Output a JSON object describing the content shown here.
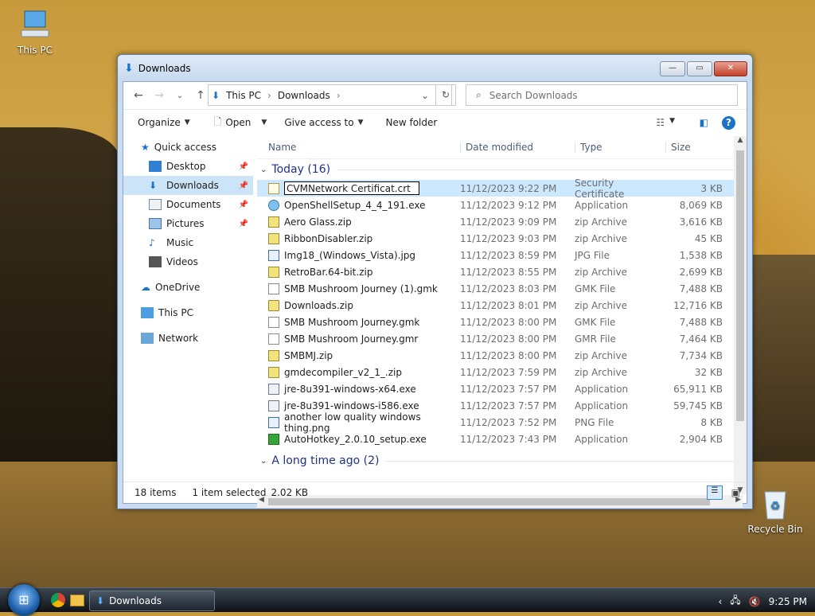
{
  "desktop": {
    "this_pc_label": "This PC",
    "recycle_bin_label": "Recycle Bin"
  },
  "window": {
    "title": "Downloads",
    "buttons": {
      "minimize": "—",
      "maximize": "▭",
      "close": "✕"
    },
    "nav": {
      "back": "←",
      "forward": "→",
      "recent": "⌄",
      "up": "↑"
    },
    "address": {
      "segments": [
        "This PC",
        "Downloads"
      ],
      "dropdown": "⌄",
      "refresh": "↻"
    },
    "search": {
      "placeholder": "Search Downloads",
      "icon": "search-icon"
    },
    "commands": {
      "organize": "Organize",
      "open": "Open",
      "give_access": "Give access to",
      "new_folder": "New folder"
    },
    "sidebar": {
      "items": [
        {
          "label": "Quick access",
          "icon": "star-icon"
        },
        {
          "label": "Desktop",
          "icon": "desktop-icon",
          "pinned": true
        },
        {
          "label": "Downloads",
          "icon": "download-icon",
          "pinned": true,
          "selected": true
        },
        {
          "label": "Documents",
          "icon": "documents-icon",
          "pinned": true
        },
        {
          "label": "Pictures",
          "icon": "pictures-icon",
          "pinned": true
        },
        {
          "label": "Music",
          "icon": "music-icon"
        },
        {
          "label": "Videos",
          "icon": "videos-icon"
        },
        {
          "label": "OneDrive",
          "icon": "cloud-icon"
        },
        {
          "label": "This PC",
          "icon": "computer-icon"
        },
        {
          "label": "Network",
          "icon": "network-icon"
        }
      ]
    },
    "columns": [
      "Name",
      "Date modified",
      "Type",
      "Size"
    ],
    "groups": {
      "today": "Today (16)",
      "long_ago": "A long time ago (2)"
    },
    "files": [
      {
        "name": "CVMNetwork Certificat.crt",
        "date": "11/12/2023 9:22 PM",
        "type": "Security Certificate",
        "size": "3 KB",
        "icon": "cert",
        "selected": true,
        "renaming": true
      },
      {
        "name": "OpenShellSetup_4_4_191.exe",
        "date": "11/12/2023 9:12 PM",
        "type": "Application",
        "size": "8,069 KB",
        "icon": "exe"
      },
      {
        "name": "Aero Glass.zip",
        "date": "11/12/2023 9:09 PM",
        "type": "zip Archive",
        "size": "3,616 KB",
        "icon": "zip"
      },
      {
        "name": "RibbonDisabler.zip",
        "date": "11/12/2023 9:03 PM",
        "type": "zip Archive",
        "size": "45 KB",
        "icon": "zip"
      },
      {
        "name": "Img18_(Windows_Vista).jpg",
        "date": "11/12/2023 8:59 PM",
        "type": "JPG File",
        "size": "1,538 KB",
        "icon": "img"
      },
      {
        "name": "RetroBar.64-bit.zip",
        "date": "11/12/2023 8:55 PM",
        "type": "zip Archive",
        "size": "2,699 KB",
        "icon": "zip"
      },
      {
        "name": "SMB Mushroom Journey (1).gmk",
        "date": "11/12/2023 8:03 PM",
        "type": "GMK File",
        "size": "7,488 KB",
        "icon": "file"
      },
      {
        "name": "Downloads.zip",
        "date": "11/12/2023 8:01 PM",
        "type": "zip Archive",
        "size": "12,716 KB",
        "icon": "zip"
      },
      {
        "name": "SMB Mushroom Journey.gmk",
        "date": "11/12/2023 8:00 PM",
        "type": "GMK File",
        "size": "7,488 KB",
        "icon": "file"
      },
      {
        "name": "SMB Mushroom Journey.gmr",
        "date": "11/12/2023 8:00 PM",
        "type": "GMR File",
        "size": "7,464 KB",
        "icon": "file"
      },
      {
        "name": "SMBMJ.zip",
        "date": "11/12/2023 8:00 PM",
        "type": "zip Archive",
        "size": "7,734 KB",
        "icon": "zip"
      },
      {
        "name": "gmdecompiler_v2_1_.zip",
        "date": "11/12/2023 7:59 PM",
        "type": "zip Archive",
        "size": "32 KB",
        "icon": "zip"
      },
      {
        "name": "jre-8u391-windows-x64.exe",
        "date": "11/12/2023 7:57 PM",
        "type": "Application",
        "size": "65,911 KB",
        "icon": "app"
      },
      {
        "name": "jre-8u391-windows-i586.exe",
        "date": "11/12/2023 7:57 PM",
        "type": "Application",
        "size": "59,745 KB",
        "icon": "app"
      },
      {
        "name": "another low quality windows thing.png",
        "date": "11/12/2023 7:52 PM",
        "type": "PNG File",
        "size": "8 KB",
        "icon": "img"
      },
      {
        "name": "AutoHotkey_2.0.10_setup.exe",
        "date": "11/12/2023 7:43 PM",
        "type": "Application",
        "size": "2,904 KB",
        "icon": "ahk"
      }
    ],
    "status": {
      "count": "18 items",
      "selected": "1 item selected",
      "size": "2.02 KB"
    }
  },
  "taskbar": {
    "window_label": "Downloads",
    "time": "9:25 PM"
  },
  "colors": {
    "selection": "#cce8ff",
    "group_header": "#1e3287",
    "accent": "#1a73c7"
  }
}
